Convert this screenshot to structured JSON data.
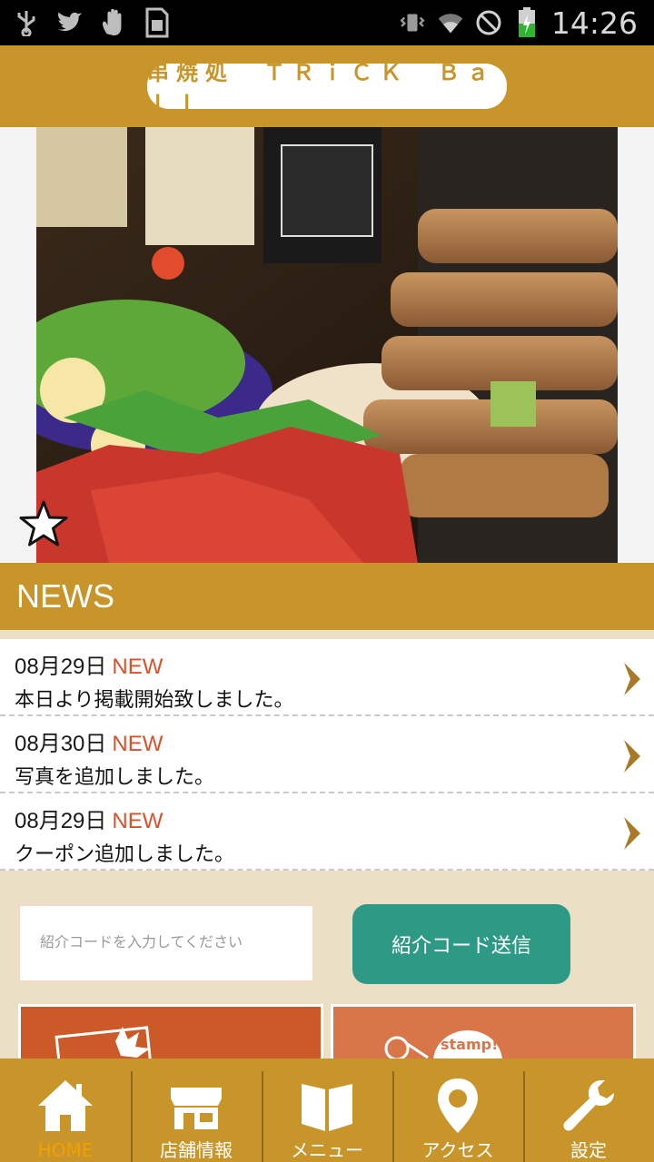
{
  "statusbar": {
    "time": "14:26",
    "left_icons": [
      "usb-icon",
      "twitter-icon",
      "hand-icon",
      "sim-icon"
    ],
    "right_icons": [
      "vibrate-icon",
      "wifi-icon",
      "dnd-icon",
      "battery-charging-icon"
    ]
  },
  "header": {
    "title": "串焼処　ＴＲｉＣＫ　Ｂａｌｌ"
  },
  "hero": {
    "badge_icon": "star-icon"
  },
  "news": {
    "heading": "NEWS",
    "items": [
      {
        "date": "08月29日",
        "badge": "NEW",
        "text": "本日より掲載開始致しました。"
      },
      {
        "date": "08月30日",
        "badge": "NEW",
        "text": "写真を追加しました。"
      },
      {
        "date": "08月29日",
        "badge": "NEW",
        "text": "クーポン追加しました。"
      }
    ]
  },
  "referral": {
    "placeholder": "紹介コードを入力してください",
    "button": "紹介コード送信"
  },
  "tiles": [
    {
      "label": "",
      "icon": "coupon-icon"
    },
    {
      "label": "stamp!",
      "icon": "stamp-icon"
    }
  ],
  "nav": {
    "items": [
      {
        "label": "HOME",
        "icon": "home-icon",
        "active": true
      },
      {
        "label": "店舗情報",
        "icon": "shop-icon"
      },
      {
        "label": "メニュー",
        "icon": "book-icon"
      },
      {
        "label": "アクセス",
        "icon": "location-pin-icon"
      },
      {
        "label": "設定",
        "icon": "wrench-icon"
      }
    ]
  },
  "colors": {
    "brand": "#c8952b",
    "accent_new": "#d9512a",
    "button": "#2e9a86"
  }
}
